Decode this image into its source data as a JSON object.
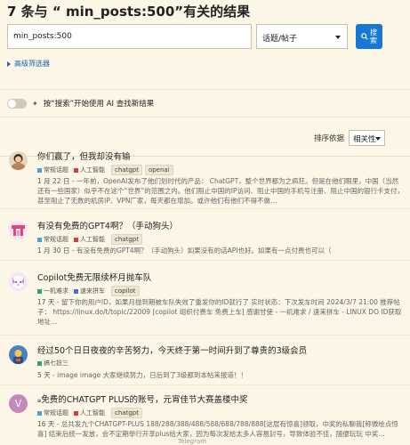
{
  "header": {
    "title": "7 条与 “ min_posts:500”有关的结果",
    "search_value": "min_posts:500",
    "scope_value": "话题/帖子",
    "search_button_label": "搜索",
    "advanced_label": "高级筛选器"
  },
  "ai_toggle": {
    "label": "按“搜索”开始使用 AI 查找新结果"
  },
  "sort": {
    "label": "排序依据",
    "value": "相关性"
  },
  "results": [
    {
      "title": "你们赢了，但我却没有输",
      "categories": [
        {
          "name": "常规话题",
          "color": "#3ba9e0"
        },
        {
          "name": "人工智能",
          "color": "#d93a3a"
        }
      ],
      "tags": [
        "chatgpt",
        "openai"
      ],
      "date": "1 月 22 日",
      "excerpt": "- 一年前，OpenAI发布了他们划时代的产品： ChatGPT，整个世界都为之疯狂。但是在他们眼里，中国（当然还有一些国家）似乎不在这个“世界”的范围之内。他们阻止中国的IP访问、阻止中国的手机号注册、阻止中国的银行卡支付，甚至阻止了无数的机房IP、VPN厂家，每天都在增加。或许他们有他们不得不做…"
    },
    {
      "title": "有没有免费的GPT4啊？（手动狗头）",
      "categories": [
        {
          "name": "常规话题",
          "color": "#3ba9e0"
        },
        {
          "name": "人工智能",
          "color": "#d93a3a"
        }
      ],
      "tags": [
        "chatgpt"
      ],
      "date": "1 月 30 日",
      "excerpt": "- 有没有免费的GPT4啊？（手动狗头）如果没有的话API也好。如果有一点付费也可以（"
    },
    {
      "title": "Copilot免费无限续杯月抛车队",
      "categories": [
        {
          "name": "一机难求",
          "color": "#2aa86a"
        },
        {
          "name": "速来拼车",
          "color": "#4a6cd6"
        }
      ],
      "tags": [
        "copilot"
      ],
      "date": "17 天",
      "excerpt": "- 留下你的用户ID，如果月抛到期被车队失效了重发你的ID就行了 实时状态：下次发车时间 2024/3/7 21:00 推荐帖子： https://linux.do/t/topic/22009 [copilot 组织付费车 免费上车] 感谢甘使 - 一机难求 / 速来拼车 - LINUX DO ID获取地址…"
    },
    {
      "title": "经过50个日日夜夜的辛苦努力，今天终于第一时间升到了尊贵的3级会员",
      "categories": [
        {
          "name": "搞七捻三",
          "color": "#2aa86a"
        }
      ],
      "tags": [],
      "date": "5 天",
      "excerpt": "- image image 大家继续努力，日后到了3级都到本帖来报道！！"
    },
    {
      "title": "免费的CHATGPT PLUS的账号，元宵佳节大赛盖楼中奖",
      "categories": [
        {
          "name": "常规话题",
          "color": "#3ba9e0"
        },
        {
          "name": "人工智能",
          "color": "#d93a3a"
        }
      ],
      "tags": [
        "chatgpt"
      ],
      "date": "16 天",
      "excerpt": "- 总共发九个CHATGPT-PLUS 188/288/388/488/588/688/788/888[这层有惊喜]领取，中奖的私聊我[称微绘点惊喜] 结束后统一发放，会不定期举行开享plus给大家，因为每次发给太多人容易封号，导致体验不佳，随便玩玩 中奖…"
    }
  ],
  "footer": {
    "label": "Telegram"
  }
}
